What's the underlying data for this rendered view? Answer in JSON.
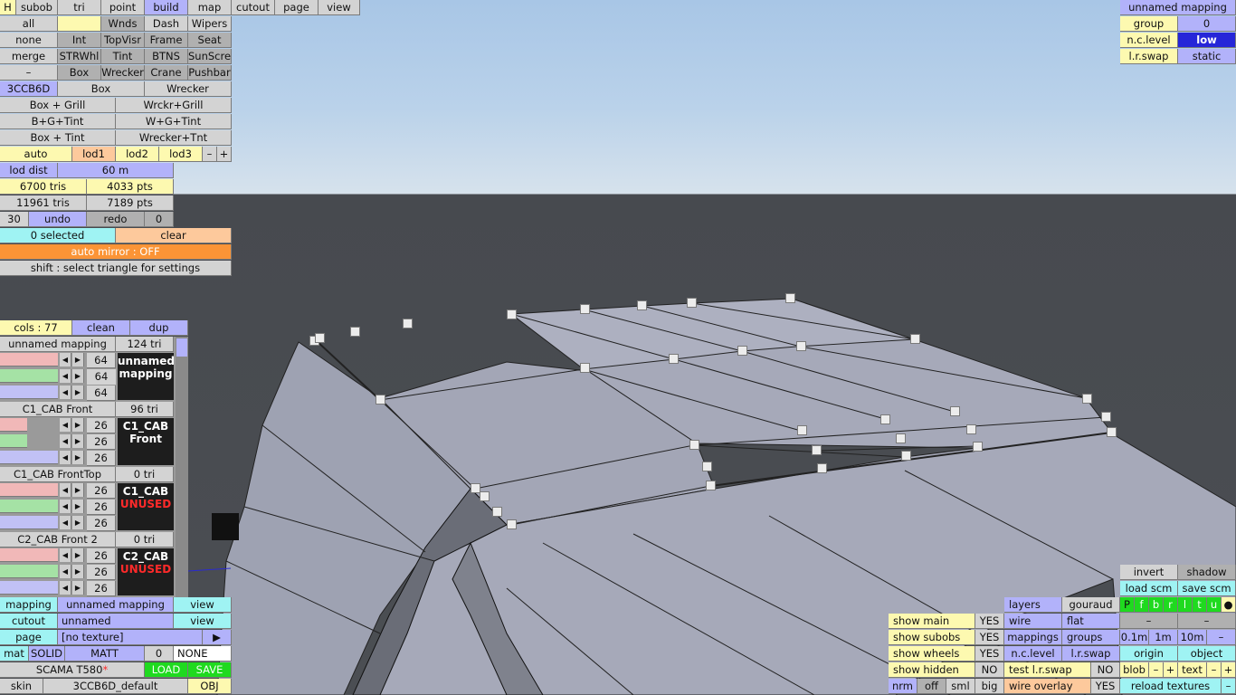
{
  "topbar": {
    "h": "H",
    "tabs": [
      "subob",
      "tri",
      "point",
      "build",
      "map",
      "cutout",
      "page",
      "view"
    ]
  },
  "builds": {
    "r1": [
      "all",
      "",
      "Wnds",
      "Dash",
      "Wipers"
    ],
    "r2": [
      "none",
      "Int",
      "TopVisr",
      "Frame",
      "Seat"
    ],
    "r3": [
      "merge",
      "STRWhl",
      "Tint",
      "BTNS",
      "SunScre"
    ],
    "r4": [
      "–",
      "",
      "Box",
      "Wrecker",
      "Crane",
      "Pushbar"
    ],
    "r5": [
      "3CCB6D",
      "Box",
      "Wrecker"
    ],
    "r6": [
      "Box + Grill",
      "Wrckr+Grill"
    ],
    "r7": [
      "B+G+Tint",
      "W+G+Tint"
    ],
    "r8": [
      "Box + Tint",
      "Wrecker+Tnt"
    ]
  },
  "lod": {
    "auto": "auto",
    "lod1": "lod1",
    "lod2": "lod2",
    "lod3": "lod3",
    "minus": "–",
    "plus": "+",
    "dist_label": "lod dist",
    "dist_value": "60 m"
  },
  "stats": {
    "tris1": "6700 tris",
    "pts1": "4033 pts",
    "tris2": "11961 tris",
    "pts2": "7189 pts",
    "undo_count": "30",
    "undo": "undo",
    "redo": "redo",
    "redo_count": "0"
  },
  "selection": {
    "selected": "0 selected",
    "clear": "clear",
    "automirror": "auto mirror : OFF",
    "hint": "shift : select triangle for settings"
  },
  "cols": {
    "label": "cols : 77",
    "clean": "clean",
    "dup": "dup"
  },
  "mappings": [
    {
      "name": "unnamed mapping",
      "tris": "124 tri",
      "vals": [
        "64",
        "64",
        "64"
      ],
      "line1": "unnamed",
      "line2": "mapping",
      "unused": false
    },
    {
      "name": "C1_CAB Front",
      "tris": "96 tri",
      "vals": [
        "26",
        "26",
        "26"
      ],
      "line1": "C1_CAB",
      "line2": "Front",
      "unused": false
    },
    {
      "name": "C1_CAB FrontTop",
      "tris": "0 tri",
      "vals": [
        "26",
        "26",
        "26"
      ],
      "line1": "C1_CAB",
      "line2": "UNUSED",
      "unused": true
    },
    {
      "name": "C2_CAB Front 2",
      "tris": "0 tri",
      "vals": [
        "26",
        "26",
        "26"
      ],
      "line1": "C2_CAB",
      "line2": "UNUSED",
      "unused": true
    }
  ],
  "bottomleft": {
    "mapping_label": "mapping",
    "mapping_value": "unnamed mapping",
    "view": "view",
    "cutout_label": "cutout",
    "cutout_value": "unnamed",
    "page_label": "page",
    "page_value": "[no texture]",
    "page_arrow": "▶",
    "mat": "mat",
    "solid": "SOLID",
    "matt": "MATT",
    "mat_num": "0",
    "none": "NONE",
    "model": "SCAMA T580",
    "star": "*",
    "load": "LOAD",
    "save": "SAVE",
    "skin": "skin",
    "skin_value": "3CCB6D_default",
    "obj": "OBJ"
  },
  "topright": {
    "title": "unnamed mapping",
    "group_label": "group",
    "group_value": "0",
    "nc_label": "n.c.level",
    "nc_value": "low",
    "lr_label": "l.r.swap",
    "lr_value": "static"
  },
  "bottomright": {
    "show_main": "show main",
    "show_main_v": "YES",
    "show_subobs": "show subobs",
    "show_subobs_v": "YES",
    "show_wheels": "show wheels",
    "show_wheels_v": "YES",
    "show_hidden": "show hidden",
    "show_hidden_v": "NO",
    "nrm": "nrm",
    "off": "off",
    "sml": "sml",
    "big": "big",
    "layers": "layers",
    "gouraud": "gouraud",
    "wire": "wire",
    "flat": "flat",
    "mappings": "mappings",
    "groups": "groups",
    "nclevel": "n.c.level",
    "lrswap": "l.r.swap",
    "test": "test l.r.swap",
    "test_v": "NO",
    "wireov": "wire overlay",
    "wireov_v": "YES",
    "invert": "invert",
    "shadow": "shadow",
    "loadscm": "load scm",
    "savescm": "save scm",
    "letters": [
      "P",
      "f",
      "b",
      "r",
      "l",
      "t",
      "u",
      "●"
    ],
    "dash1": "–",
    "dash2": "–",
    "d01": "0.1m",
    "d1": "1m",
    "d10": "10m",
    "dminus": "–",
    "origin": "origin",
    "object": "object",
    "blob": "blob",
    "bminus": "–",
    "bplus": "+",
    "text": "text",
    "tminus": "–",
    "tplus": "+",
    "reload": "reload textures",
    "rminus": "–"
  },
  "colors": {
    "accent": "#b2b2fa",
    "selected": "#2626d8",
    "load": "#1fda1f",
    "automirror": "#fb9436"
  }
}
